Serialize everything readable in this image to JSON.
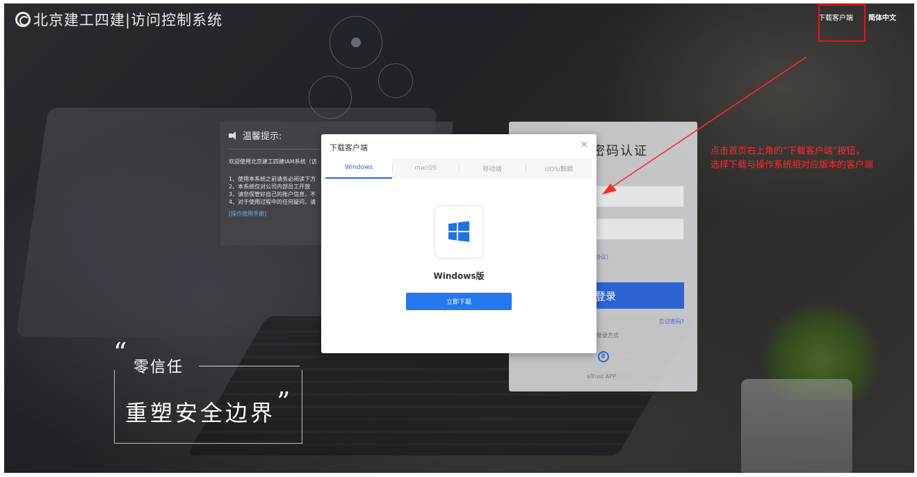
{
  "header": {
    "brand": "北京建工四建|访问控制系统",
    "download_client": "下载客户端",
    "language": "简体中文"
  },
  "notice": {
    "title": "温馨提示:",
    "welcome": "欢迎使用北京建工四建IAM系统（访",
    "items": [
      "1、使用本系统之前请务必阅读下方",
      "2、本系统仅对公司内部员工开放",
      "3、请您保管好自己的账户信息，不",
      "4、对于使用过程中的任何疑问，请"
    ],
    "manual_link": "[操作使用手册]"
  },
  "login": {
    "title": "密码认证",
    "agreement": "协议)",
    "button": "登录",
    "forgot": "忘记密码?",
    "other_methods": "登录方式",
    "atrust_icon_glyph": "Ƨ",
    "atrust": "aTrust APP"
  },
  "modal": {
    "title": "下载客户端",
    "close": "×",
    "tabs": [
      "Windows",
      "macOS",
      "移动端",
      "UOS/麒麟"
    ],
    "active_tab": 0,
    "os_label": "Windows版",
    "download_button": "立即下载"
  },
  "annotation": {
    "line1": "点击首页右上角的“下载客户端”按钮，",
    "line2": "选择下载与操作系统相对应版本的客户端"
  },
  "slogan": {
    "quote_open": "“",
    "line1": "零信任",
    "line2": "重塑安全边界",
    "quote_close": "”"
  },
  "colors": {
    "primary": "#2e63d6",
    "download": "#2577ef",
    "annotation": "#ff2a2a"
  }
}
